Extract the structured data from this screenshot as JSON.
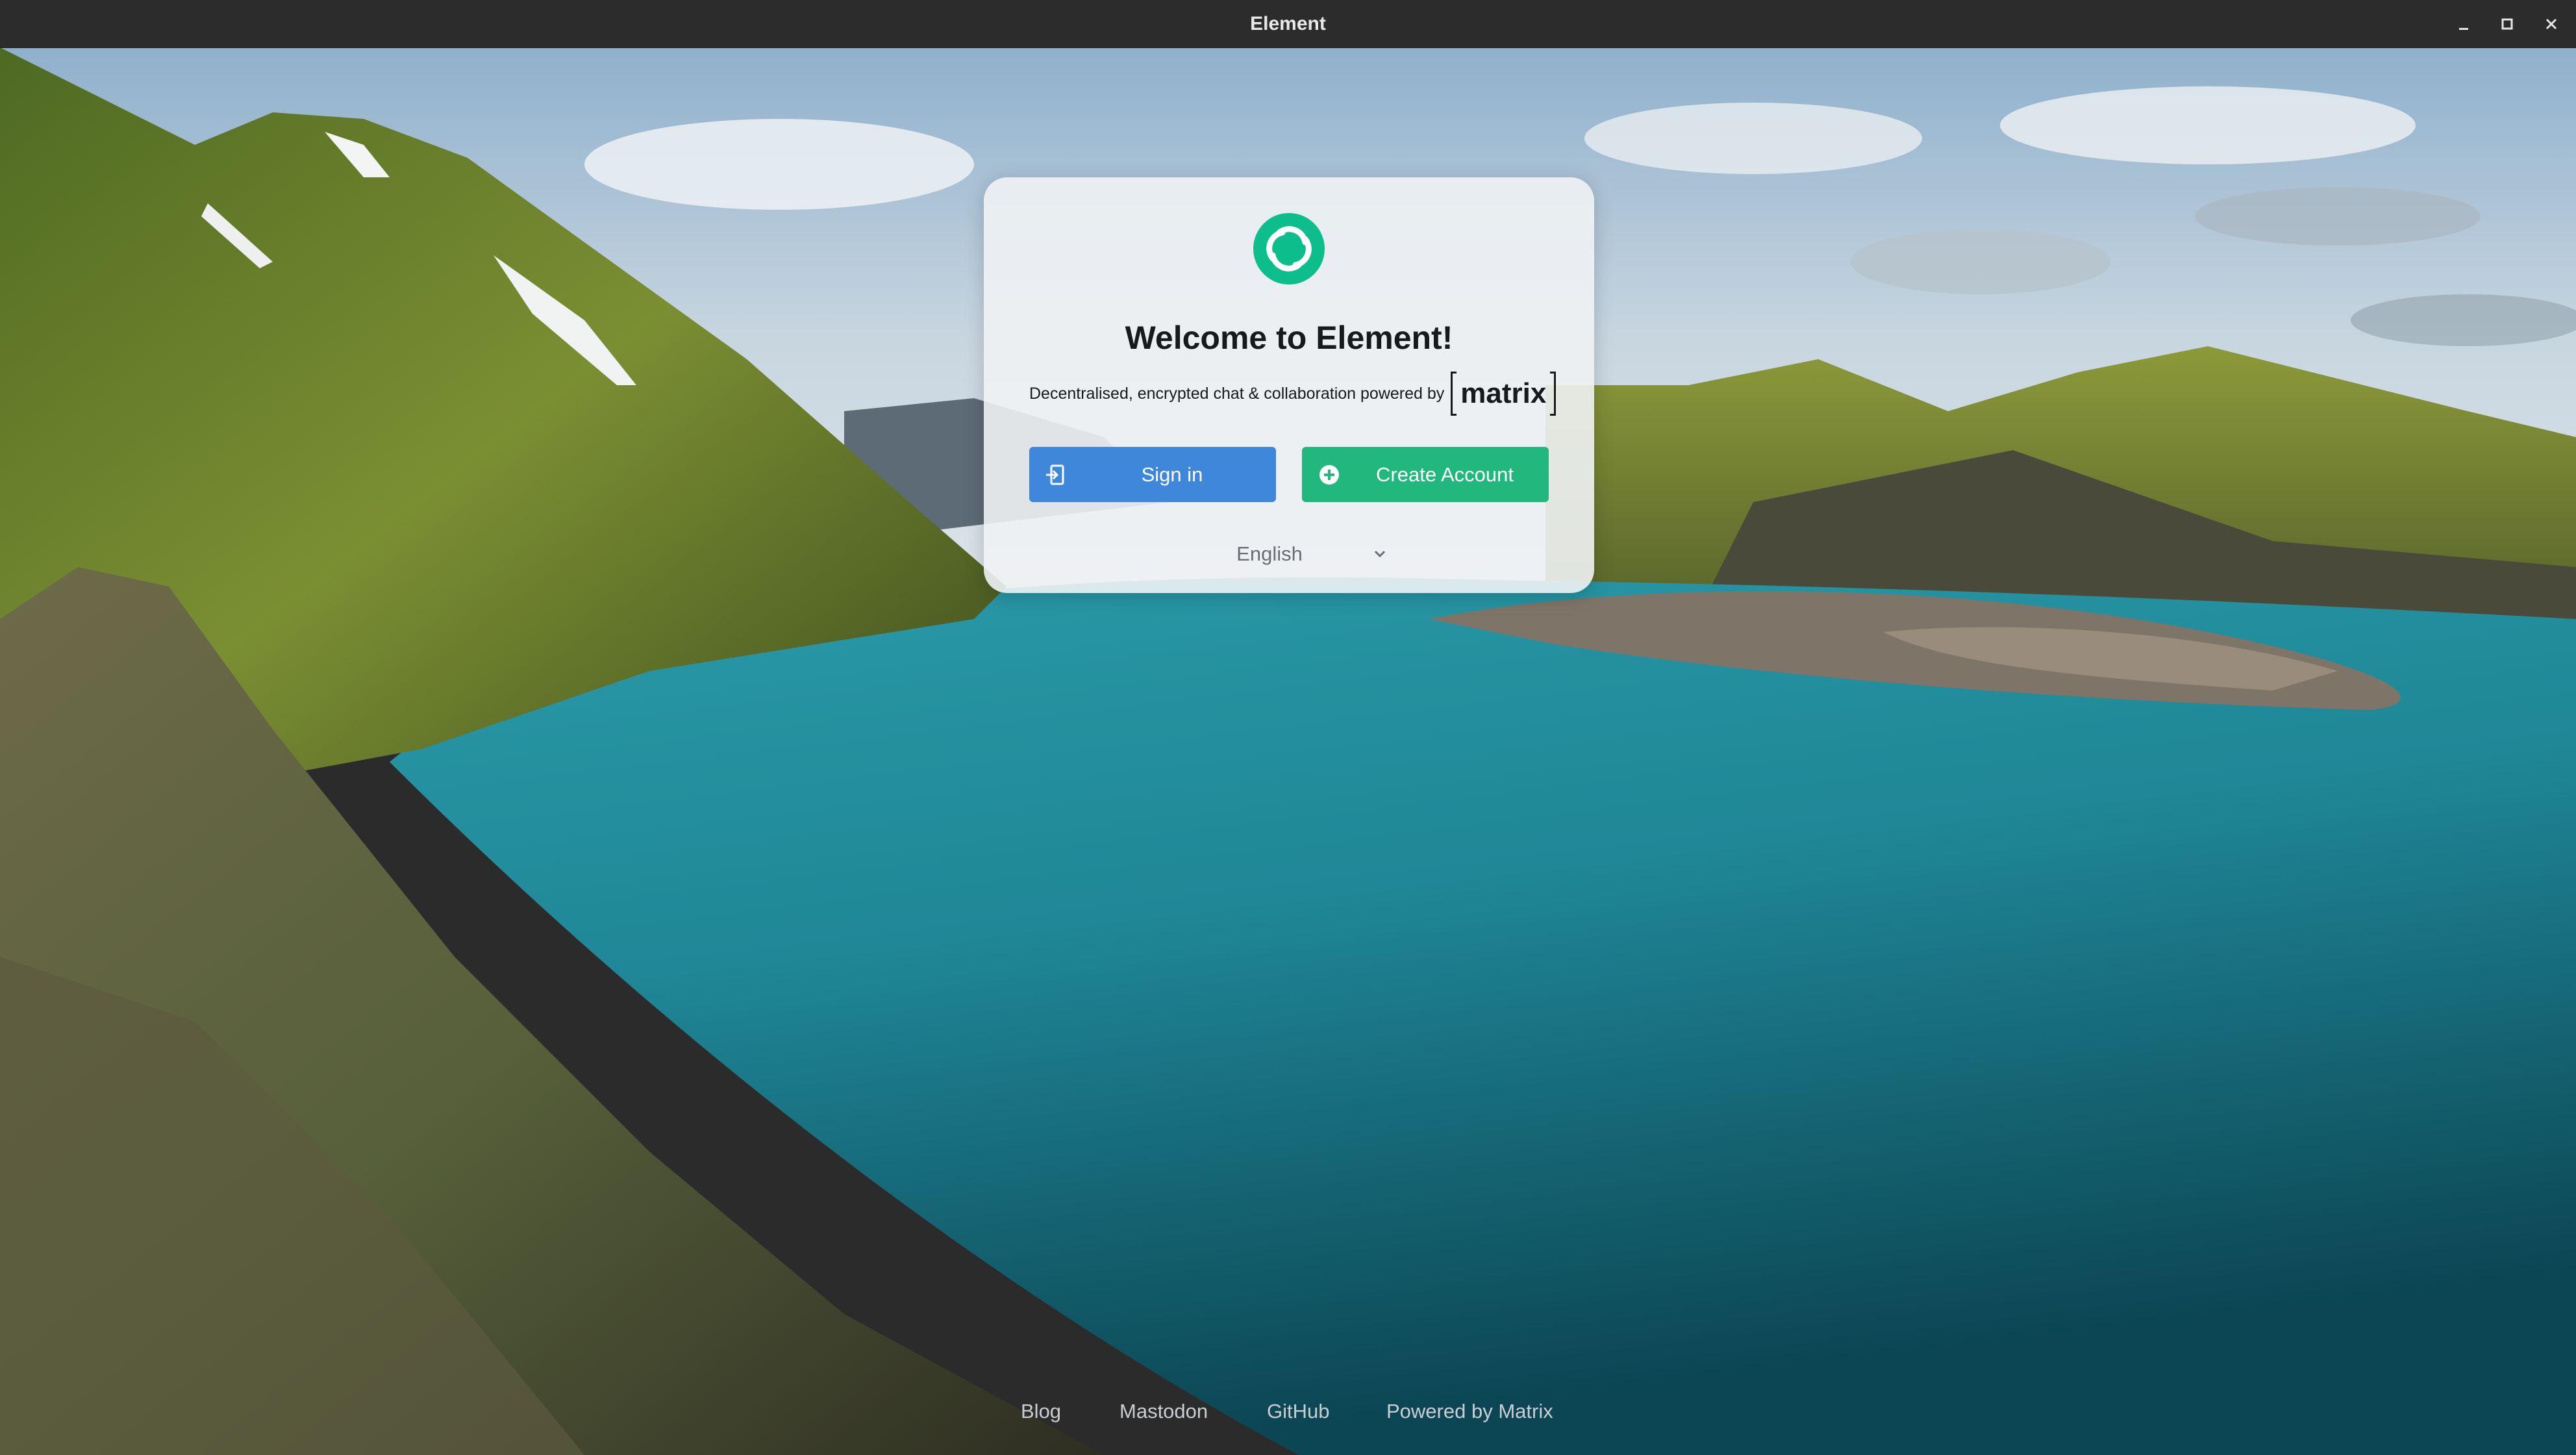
{
  "window": {
    "title": "Element"
  },
  "card": {
    "title": "Welcome to Element!",
    "tagline": "Decentralised, encrypted chat & collaboration powered by",
    "matrix_wordmark": "matrix",
    "sign_in_label": "Sign in",
    "create_account_label": "Create Account",
    "language_value": "English"
  },
  "footer": {
    "links": [
      "Blog",
      "Mastodon",
      "GitHub",
      "Powered by Matrix"
    ]
  },
  "colors": {
    "brand_green": "#0dbd8b",
    "sign_in_blue": "#3f87db",
    "create_green": "#21b77d",
    "titlebar": "#2c2c2c"
  },
  "icons": {
    "sign_in": "sign-in-icon",
    "create_account": "plus-circle-icon",
    "language_dropdown": "chevron-down-icon",
    "logo": "element-logo-icon"
  }
}
